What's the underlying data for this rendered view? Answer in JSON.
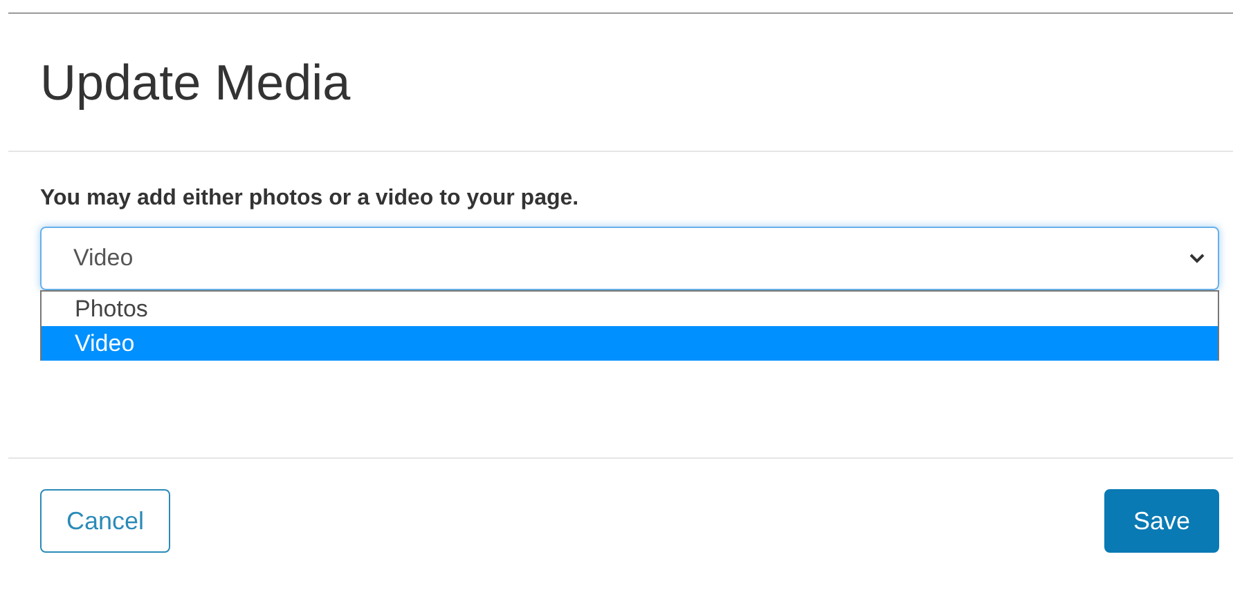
{
  "dialog": {
    "title": "Update Media"
  },
  "prompt": "You may add either photos or a video to your page.",
  "media_select": {
    "value": "Video",
    "expanded": true,
    "options": [
      {
        "label": "Photos",
        "selected": false
      },
      {
        "label": "Video",
        "selected": true
      }
    ]
  },
  "buttons": [
    {
      "label": "Cancel",
      "kind": "secondary"
    },
    {
      "label": "Save",
      "kind": "primary"
    }
  ]
}
